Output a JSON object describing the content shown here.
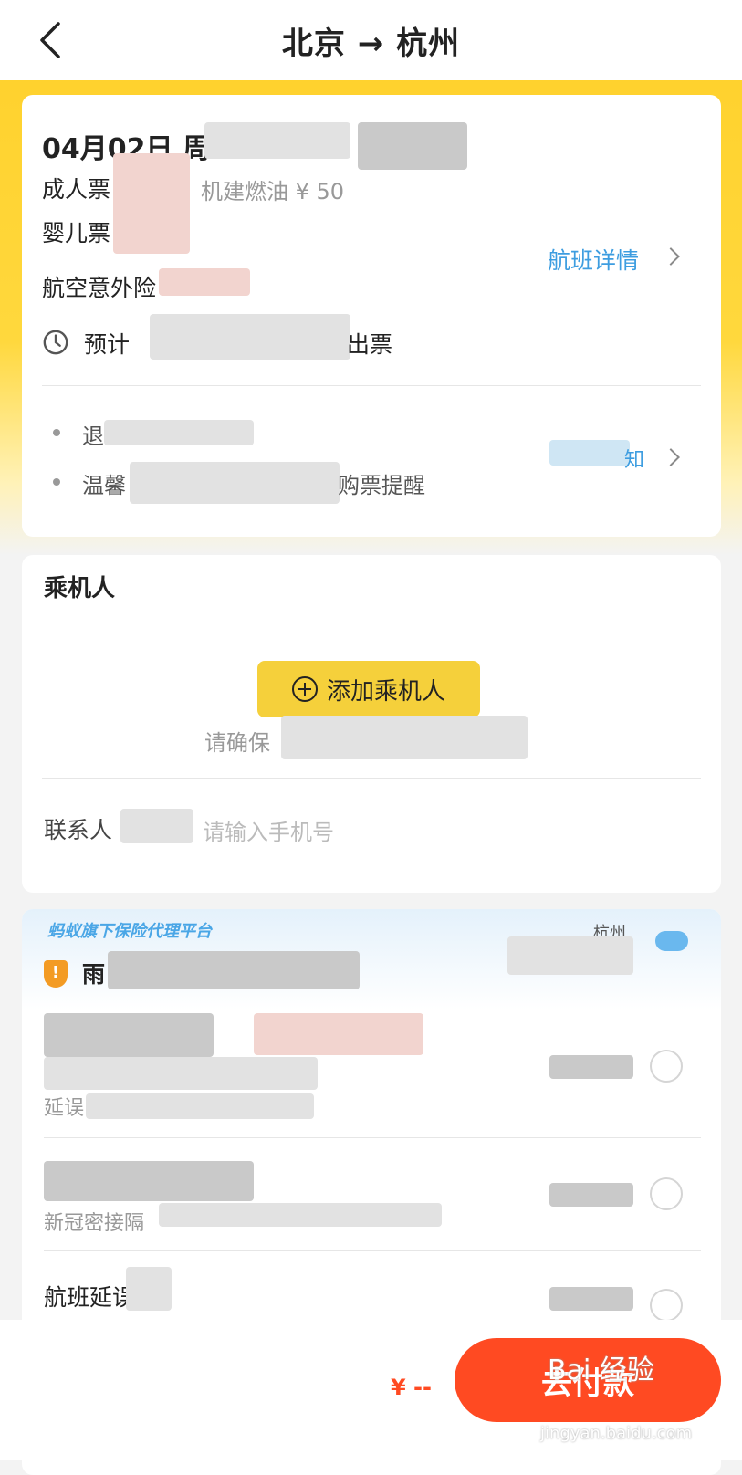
{
  "nav": {
    "title": "北京 → 杭州"
  },
  "flight": {
    "date": "04月02日 周",
    "adult_label": "成人票",
    "fuel": "机建燃油 ¥ 50",
    "infant_label": "婴儿票",
    "insurance_label": "航空意外险",
    "detail_link": "航班详情",
    "eta_prefix": "预计",
    "eta_suffix": "出票",
    "notice_1_prefix": "退",
    "notice_2_prefix": "温馨",
    "notice_2_suffix": "购票提醒",
    "notice_link": "知"
  },
  "passenger": {
    "title": "乘机人",
    "add_label": "添加乘机人",
    "hint_prefix": "请确保",
    "contact_label": "联系人",
    "phone_placeholder": "请输入手机号"
  },
  "insurance": {
    "banner": "蚂蚁旗下保险代理平台",
    "title_prefix": "雨",
    "city": "杭州",
    "item_1_line2": "延误",
    "item_2_line2": "新冠密接隔",
    "item_3_line1": "航班延误"
  },
  "footer": {
    "price": "¥ --",
    "pay_label": "去付款",
    "watermark": "Bai 经验",
    "watermark_url": "jingyan.baidu.com"
  },
  "colors": {
    "accent_yellow": "#ffd22e",
    "link_blue": "#3d9de0",
    "pay_red": "#ff4a22"
  }
}
